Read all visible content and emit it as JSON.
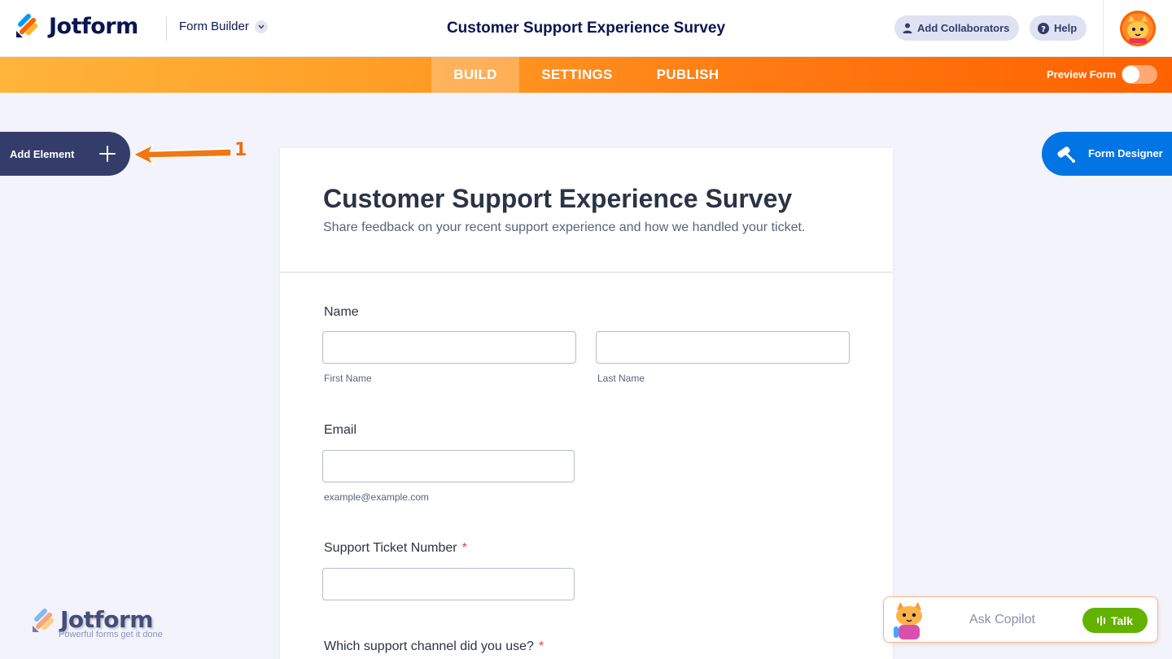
{
  "header": {
    "brand": "Jotform",
    "builder_dropdown": "Form Builder",
    "page_title": "Customer Support Experience Survey",
    "add_collaborators": "Add Collaborators",
    "help": "Help"
  },
  "nav": {
    "tabs": [
      {
        "label": "BUILD",
        "active": true
      },
      {
        "label": "SETTINGS",
        "active": false
      },
      {
        "label": "PUBLISH",
        "active": false
      }
    ],
    "preview_label": "Preview Form",
    "preview_enabled": false
  },
  "sidebar": {
    "add_element": "Add Element",
    "form_designer": "Form Designer"
  },
  "annotation": {
    "number": "1"
  },
  "form": {
    "title": "Customer Support Experience Survey",
    "subtitle": "Share feedback on your recent support experience and how we handled your ticket.",
    "fields": {
      "name": {
        "label": "Name",
        "first_sublabel": "First Name",
        "last_sublabel": "Last Name",
        "first_value": "",
        "last_value": ""
      },
      "email": {
        "label": "Email",
        "sublabel": "example@example.com",
        "value": ""
      },
      "ticket": {
        "label": "Support Ticket Number",
        "required": "*",
        "value": ""
      },
      "channel": {
        "label": "Which support channel did you use?",
        "required": "*"
      }
    }
  },
  "watermark": {
    "brand": "Jotform",
    "tagline": "Powerful forms get it done"
  },
  "copilot": {
    "placeholder": "Ask Copilot",
    "talk": "Talk"
  },
  "colors": {
    "brand_orange": "#ff6100",
    "navy": "#0a1551",
    "designer_blue": "#0075e3",
    "talk_green": "#64b200",
    "required_red": "#f23a3c"
  }
}
